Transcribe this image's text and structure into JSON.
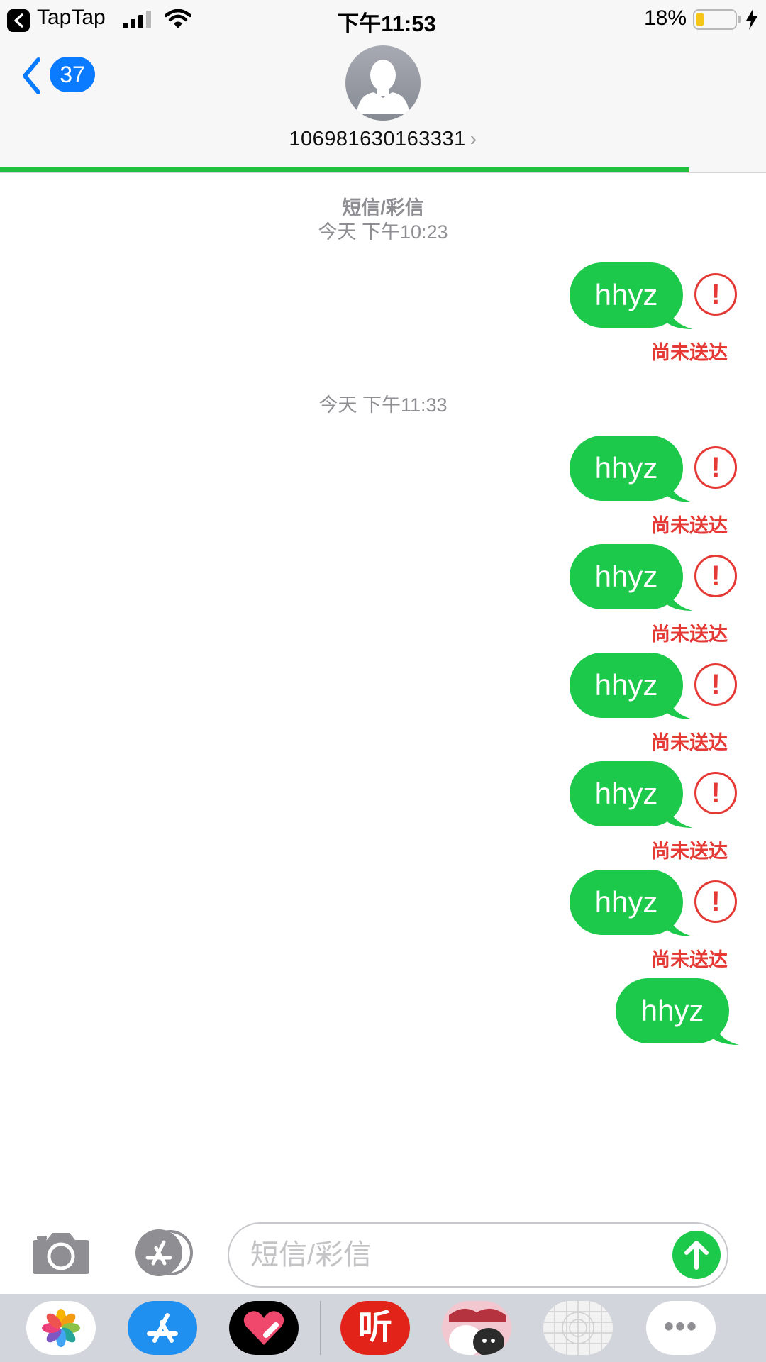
{
  "status_bar": {
    "back_app": "TapTap",
    "time": "下午11:53",
    "battery_percent": "18%",
    "battery_level": 0.18,
    "icons": [
      "back-to-app-icon",
      "cellular-signal-icon",
      "wifi-icon",
      "battery-icon",
      "charging-bolt-icon"
    ]
  },
  "header": {
    "unread_count": "37",
    "contact": "106981630163331",
    "chevron": "›",
    "load_progress": 0.9
  },
  "conversation": {
    "service_label": "短信/彩信",
    "timestamps": [
      "今天 下午10:23",
      "今天 下午11:33"
    ],
    "messages": [
      {
        "text": "hhyz",
        "status": "尚未送达"
      },
      {
        "text": "hhyz",
        "status": "尚未送达"
      },
      {
        "text": "hhyz",
        "status": "尚未送达"
      },
      {
        "text": "hhyz",
        "status": "尚未送达"
      },
      {
        "text": "hhyz",
        "status": "尚未送达"
      },
      {
        "text": "hhyz",
        "status": "尚未送达"
      },
      {
        "text": "hhyz",
        "status": ""
      }
    ],
    "fail_icon_glyph": "!"
  },
  "composer": {
    "placeholder": "短信/彩信",
    "value": ""
  },
  "app_drawer": {
    "apps": [
      "photos-app-icon",
      "app-store-icon",
      "digital-touch-icon",
      "ting-app-icon",
      "sticker-app-icon",
      "grid-app-icon",
      "more-apps-icon"
    ],
    "ting_label": "听",
    "more_label": "•••"
  },
  "colors": {
    "bubble": "#1dc94a",
    "error": "#e53935",
    "ios_blue": "#0a7aff",
    "progress": "#20c140"
  }
}
